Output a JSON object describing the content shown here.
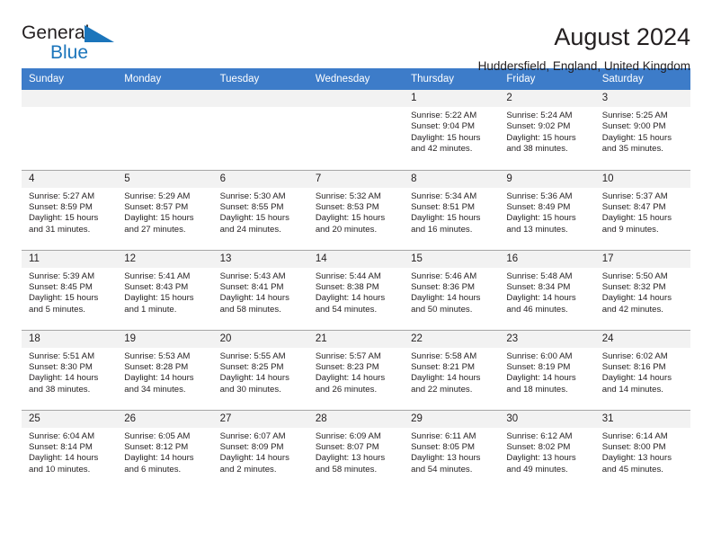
{
  "brand": {
    "name_top": "General",
    "name_bottom": "Blue"
  },
  "header": {
    "title": "August 2024",
    "subtitle": "Huddersfield, England, United Kingdom"
  },
  "colors": {
    "header_blue": "#3d7cc9",
    "brand_blue": "#1b75bb",
    "daynum_band": "#f2f2f2",
    "grid_line": "#a6a6a6",
    "text": "#231f20"
  },
  "weekdays": [
    "Sunday",
    "Monday",
    "Tuesday",
    "Wednesday",
    "Thursday",
    "Friday",
    "Saturday"
  ],
  "labels": {
    "sunrise": "Sunrise:",
    "sunset": "Sunset:",
    "daylight": "Daylight:"
  },
  "weeks": [
    [
      {
        "day": ""
      },
      {
        "day": ""
      },
      {
        "day": ""
      },
      {
        "day": ""
      },
      {
        "day": "1",
        "sunrise": "Sunrise: 5:22 AM",
        "sunset": "Sunset: 9:04 PM",
        "daylight": "Daylight: 15 hours and 42 minutes."
      },
      {
        "day": "2",
        "sunrise": "Sunrise: 5:24 AM",
        "sunset": "Sunset: 9:02 PM",
        "daylight": "Daylight: 15 hours and 38 minutes."
      },
      {
        "day": "3",
        "sunrise": "Sunrise: 5:25 AM",
        "sunset": "Sunset: 9:00 PM",
        "daylight": "Daylight: 15 hours and 35 minutes."
      }
    ],
    [
      {
        "day": "4",
        "sunrise": "Sunrise: 5:27 AM",
        "sunset": "Sunset: 8:59 PM",
        "daylight": "Daylight: 15 hours and 31 minutes."
      },
      {
        "day": "5",
        "sunrise": "Sunrise: 5:29 AM",
        "sunset": "Sunset: 8:57 PM",
        "daylight": "Daylight: 15 hours and 27 minutes."
      },
      {
        "day": "6",
        "sunrise": "Sunrise: 5:30 AM",
        "sunset": "Sunset: 8:55 PM",
        "daylight": "Daylight: 15 hours and 24 minutes."
      },
      {
        "day": "7",
        "sunrise": "Sunrise: 5:32 AM",
        "sunset": "Sunset: 8:53 PM",
        "daylight": "Daylight: 15 hours and 20 minutes."
      },
      {
        "day": "8",
        "sunrise": "Sunrise: 5:34 AM",
        "sunset": "Sunset: 8:51 PM",
        "daylight": "Daylight: 15 hours and 16 minutes."
      },
      {
        "day": "9",
        "sunrise": "Sunrise: 5:36 AM",
        "sunset": "Sunset: 8:49 PM",
        "daylight": "Daylight: 15 hours and 13 minutes."
      },
      {
        "day": "10",
        "sunrise": "Sunrise: 5:37 AM",
        "sunset": "Sunset: 8:47 PM",
        "daylight": "Daylight: 15 hours and 9 minutes."
      }
    ],
    [
      {
        "day": "11",
        "sunrise": "Sunrise: 5:39 AM",
        "sunset": "Sunset: 8:45 PM",
        "daylight": "Daylight: 15 hours and 5 minutes."
      },
      {
        "day": "12",
        "sunrise": "Sunrise: 5:41 AM",
        "sunset": "Sunset: 8:43 PM",
        "daylight": "Daylight: 15 hours and 1 minute."
      },
      {
        "day": "13",
        "sunrise": "Sunrise: 5:43 AM",
        "sunset": "Sunset: 8:41 PM",
        "daylight": "Daylight: 14 hours and 58 minutes."
      },
      {
        "day": "14",
        "sunrise": "Sunrise: 5:44 AM",
        "sunset": "Sunset: 8:38 PM",
        "daylight": "Daylight: 14 hours and 54 minutes."
      },
      {
        "day": "15",
        "sunrise": "Sunrise: 5:46 AM",
        "sunset": "Sunset: 8:36 PM",
        "daylight": "Daylight: 14 hours and 50 minutes."
      },
      {
        "day": "16",
        "sunrise": "Sunrise: 5:48 AM",
        "sunset": "Sunset: 8:34 PM",
        "daylight": "Daylight: 14 hours and 46 minutes."
      },
      {
        "day": "17",
        "sunrise": "Sunrise: 5:50 AM",
        "sunset": "Sunset: 8:32 PM",
        "daylight": "Daylight: 14 hours and 42 minutes."
      }
    ],
    [
      {
        "day": "18",
        "sunrise": "Sunrise: 5:51 AM",
        "sunset": "Sunset: 8:30 PM",
        "daylight": "Daylight: 14 hours and 38 minutes."
      },
      {
        "day": "19",
        "sunrise": "Sunrise: 5:53 AM",
        "sunset": "Sunset: 8:28 PM",
        "daylight": "Daylight: 14 hours and 34 minutes."
      },
      {
        "day": "20",
        "sunrise": "Sunrise: 5:55 AM",
        "sunset": "Sunset: 8:25 PM",
        "daylight": "Daylight: 14 hours and 30 minutes."
      },
      {
        "day": "21",
        "sunrise": "Sunrise: 5:57 AM",
        "sunset": "Sunset: 8:23 PM",
        "daylight": "Daylight: 14 hours and 26 minutes."
      },
      {
        "day": "22",
        "sunrise": "Sunrise: 5:58 AM",
        "sunset": "Sunset: 8:21 PM",
        "daylight": "Daylight: 14 hours and 22 minutes."
      },
      {
        "day": "23",
        "sunrise": "Sunrise: 6:00 AM",
        "sunset": "Sunset: 8:19 PM",
        "daylight": "Daylight: 14 hours and 18 minutes."
      },
      {
        "day": "24",
        "sunrise": "Sunrise: 6:02 AM",
        "sunset": "Sunset: 8:16 PM",
        "daylight": "Daylight: 14 hours and 14 minutes."
      }
    ],
    [
      {
        "day": "25",
        "sunrise": "Sunrise: 6:04 AM",
        "sunset": "Sunset: 8:14 PM",
        "daylight": "Daylight: 14 hours and 10 minutes."
      },
      {
        "day": "26",
        "sunrise": "Sunrise: 6:05 AM",
        "sunset": "Sunset: 8:12 PM",
        "daylight": "Daylight: 14 hours and 6 minutes."
      },
      {
        "day": "27",
        "sunrise": "Sunrise: 6:07 AM",
        "sunset": "Sunset: 8:09 PM",
        "daylight": "Daylight: 14 hours and 2 minutes."
      },
      {
        "day": "28",
        "sunrise": "Sunrise: 6:09 AM",
        "sunset": "Sunset: 8:07 PM",
        "daylight": "Daylight: 13 hours and 58 minutes."
      },
      {
        "day": "29",
        "sunrise": "Sunrise: 6:11 AM",
        "sunset": "Sunset: 8:05 PM",
        "daylight": "Daylight: 13 hours and 54 minutes."
      },
      {
        "day": "30",
        "sunrise": "Sunrise: 6:12 AM",
        "sunset": "Sunset: 8:02 PM",
        "daylight": "Daylight: 13 hours and 49 minutes."
      },
      {
        "day": "31",
        "sunrise": "Sunrise: 6:14 AM",
        "sunset": "Sunset: 8:00 PM",
        "daylight": "Daylight: 13 hours and 45 minutes."
      }
    ]
  ]
}
